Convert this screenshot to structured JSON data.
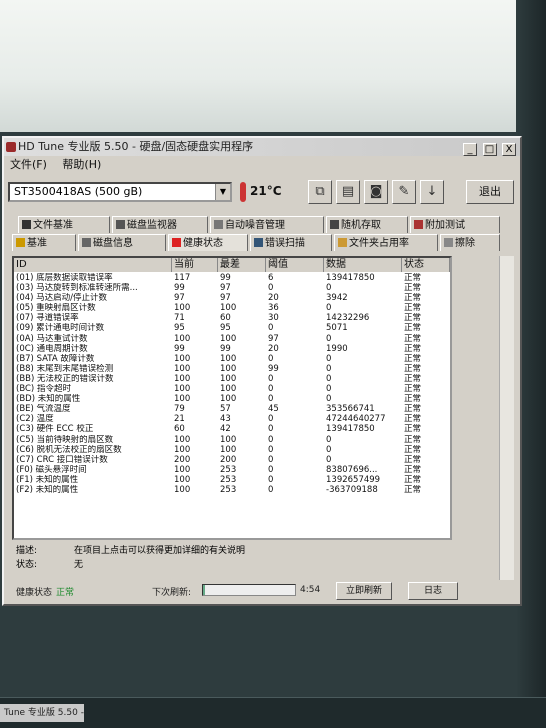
{
  "window": {
    "title": "HD Tune 专业版 5.50 - 硬盘/固态硬盘实用程序",
    "controls": [
      "_",
      "□",
      "X"
    ]
  },
  "menu": [
    "文件(F)",
    "帮助(H)"
  ],
  "toolbar": {
    "drive": "ST3500418AS (500 gB)",
    "temperature": "21°C",
    "exit_label": "退出",
    "icons": [
      "copy-icon",
      "paste-icon",
      "camera-icon",
      "wrench-icon",
      "download-icon"
    ]
  },
  "tabs_row1": [
    "文件基准",
    "磁盘监视器",
    "自动噪音管理",
    "随机存取",
    "附加测试"
  ],
  "tabs_row2": [
    "基准",
    "磁盘信息",
    "健康状态",
    "错误扫描",
    "文件夹占用率",
    "擦除"
  ],
  "table": {
    "headers": [
      "ID",
      "当前",
      "最差",
      "阈值",
      "数据",
      "状态"
    ],
    "rows": [
      [
        "(01) 底层数据读取错误率",
        "117",
        "99",
        "6",
        "139417850",
        "正常"
      ],
      [
        "(03) 马达旋转到标准转速所需...",
        "99",
        "97",
        "0",
        "0",
        "正常"
      ],
      [
        "(04) 马达启动/停止计数",
        "97",
        "97",
        "20",
        "3942",
        "正常"
      ],
      [
        "(05) 重映射扇区计数",
        "100",
        "100",
        "36",
        "0",
        "正常"
      ],
      [
        "(07) 寻道错误率",
        "71",
        "60",
        "30",
        "14232296",
        "正常"
      ],
      [
        "(09) 累计通电时间计数",
        "95",
        "95",
        "0",
        "5071",
        "正常"
      ],
      [
        "(0A) 马达重试计数",
        "100",
        "100",
        "97",
        "0",
        "正常"
      ],
      [
        "(0C) 通电周期计数",
        "99",
        "99",
        "20",
        "1990",
        "正常"
      ],
      [
        "(B7) SATA 故障计数",
        "100",
        "100",
        "0",
        "0",
        "正常"
      ],
      [
        "(B8) 末尾到末尾错误检测",
        "100",
        "100",
        "99",
        "0",
        "正常"
      ],
      [
        "(BB) 无法校正的错误计数",
        "100",
        "100",
        "0",
        "0",
        "正常"
      ],
      [
        "(BC) 指令超时",
        "100",
        "100",
        "0",
        "0",
        "正常"
      ],
      [
        "(BD) 未知的属性",
        "100",
        "100",
        "0",
        "0",
        "正常"
      ],
      [
        "(BE) 气流温度",
        "79",
        "57",
        "45",
        "353566741",
        "正常"
      ],
      [
        "(C2) 温度",
        "21",
        "43",
        "0",
        "47244640277",
        "正常"
      ],
      [
        "(C3) 硬件 ECC 校正",
        "60",
        "42",
        "0",
        "139417850",
        "正常"
      ],
      [
        "(C5) 当前待映射的扇区数",
        "100",
        "100",
        "0",
        "0",
        "正常"
      ],
      [
        "(C6) 脱机无法校正的扇区数",
        "100",
        "100",
        "0",
        "0",
        "正常"
      ],
      [
        "(C7) CRC 接口错误计数",
        "200",
        "200",
        "0",
        "0",
        "正常"
      ],
      [
        "(F0) 磁头悬浮时间",
        "100",
        "253",
        "0",
        "83807696...",
        "正常"
      ],
      [
        "(F1) 未知的属性",
        "100",
        "253",
        "0",
        "1392657499",
        "正常"
      ],
      [
        "(F2) 未知的属性",
        "100",
        "253",
        "0",
        "-363709188",
        "正常"
      ]
    ]
  },
  "description": {
    "label_desc": "描述:",
    "desc_text": "在项目上点击可以获得更加详细的有关说明",
    "label_state": "状态:",
    "state_text": "无"
  },
  "status": {
    "health_label": "健康状态",
    "health_value": "正常",
    "next_refresh_label": "下次刷新:",
    "countdown": "4:54",
    "refresh_progress": 0.02,
    "refresh_now_label": "立即刷新",
    "log_label": "日志"
  },
  "taskbar": {
    "item": "Tune 专业版 5.50 -..."
  },
  "colors": {
    "window_bg": "#d4d0c8",
    "health_ok": "#1e8a2e",
    "thermometer": "#cc3333"
  }
}
